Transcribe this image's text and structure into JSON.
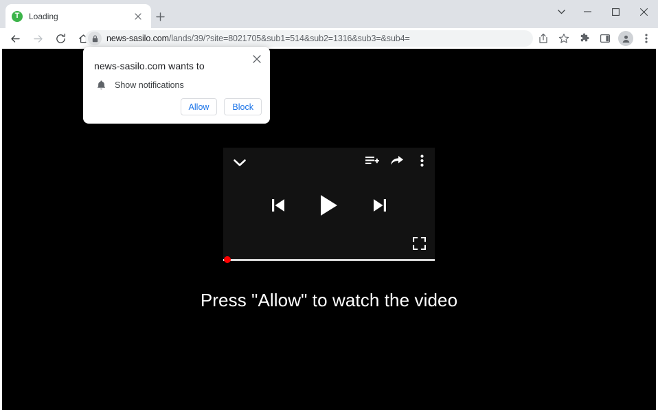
{
  "browser": {
    "tab": {
      "title": "Loading",
      "favicon_letter": "T",
      "favicon_color": "#3cb44a",
      "close_icon": "close-icon"
    },
    "new_tab_label": "+",
    "window_controls": {
      "tab_search": "chevron-down-icon",
      "minimize": "minimize-icon",
      "maximize": "maximize-icon",
      "close": "close-icon"
    },
    "nav": {
      "back": "back-arrow-icon",
      "forward": "forward-arrow-icon",
      "reload": "reload-icon",
      "home": "home-icon"
    },
    "omnibox": {
      "lock_icon": "lock-icon",
      "url_host": "news-sasilo.com",
      "url_path": "/lands/39/?site=8021705&sub1=514&sub2=1316&sub3=&sub4=",
      "url_full": "news-sasilo.com/lands/39/?site=8021705&sub1=514&sub2=1316&sub3=&sub4="
    },
    "toolbar_icons": [
      {
        "name": "share-icon"
      },
      {
        "name": "bookmark-star-icon"
      },
      {
        "name": "extensions-puzzle-icon"
      },
      {
        "name": "side-panel-icon"
      },
      {
        "name": "profile-avatar-icon"
      },
      {
        "name": "chrome-menu-icon"
      }
    ]
  },
  "notification_prompt": {
    "title": "news-sasilo.com wants to",
    "permission_label": "Show notifications",
    "bell_icon": "bell-icon",
    "close_icon": "close-icon",
    "allow_label": "Allow",
    "block_label": "Block",
    "accent_color": "#1a73e8"
  },
  "page": {
    "background_color": "#000000",
    "caption": "Press \"Allow\" to watch the video",
    "player": {
      "background_color": "#121212",
      "collapse_icon": "chevron-down-icon",
      "add_to_queue_icon": "add-to-queue-icon",
      "share_icon": "share-arrow-icon",
      "more_icon": "kebab-menu-icon",
      "previous_icon": "previous-track-icon",
      "play_icon": "play-icon",
      "next_icon": "next-track-icon",
      "fullscreen_icon": "fullscreen-icon",
      "progress_value": 0,
      "progress_color": "#ff0000",
      "track_color": "#d8d8d8"
    }
  }
}
